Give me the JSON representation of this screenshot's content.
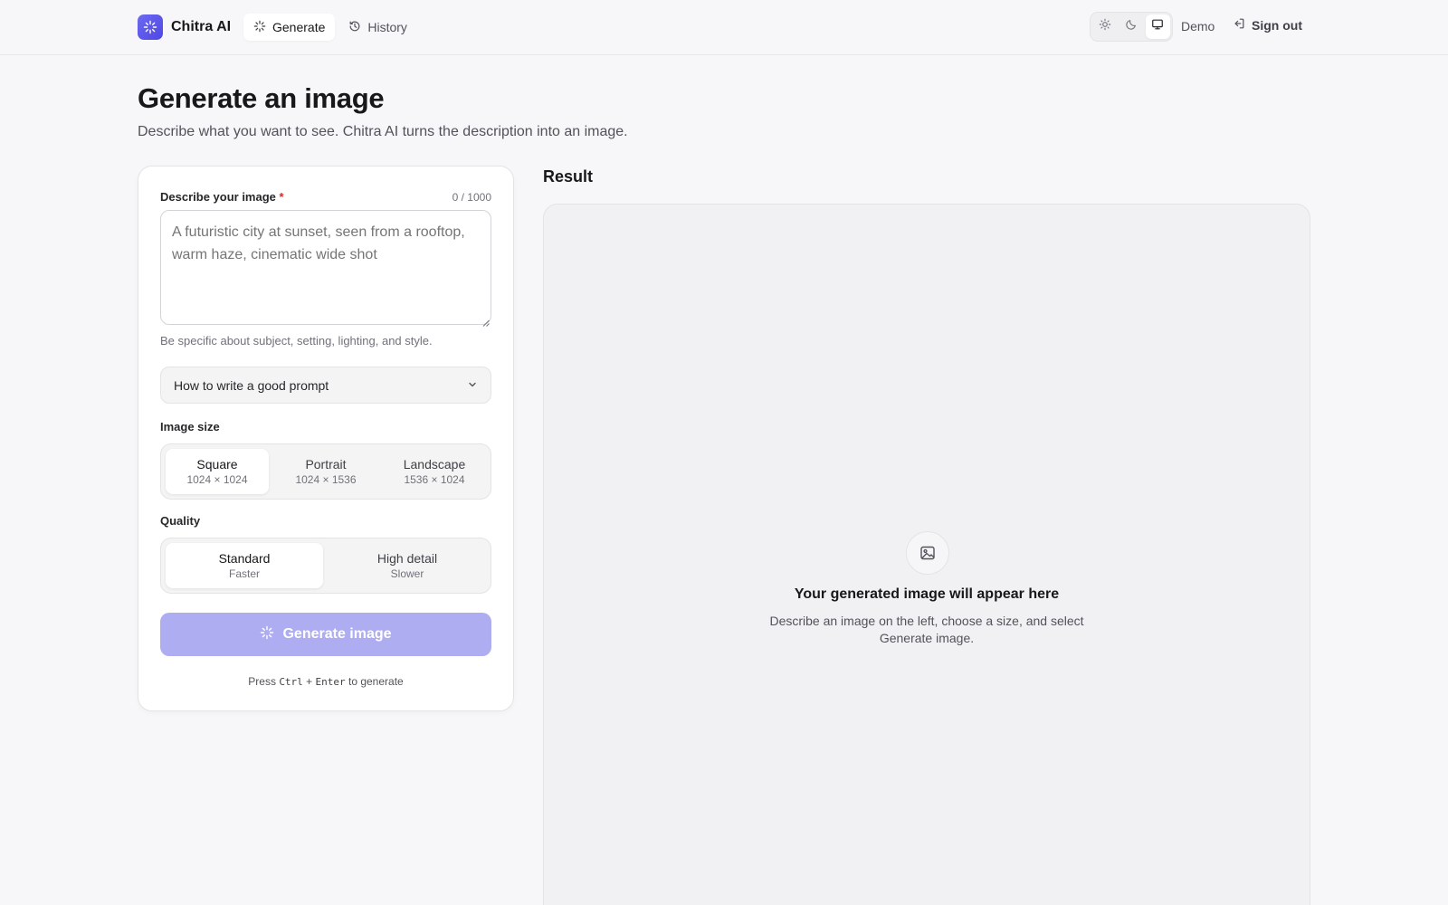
{
  "header": {
    "brand": "Chitra AI",
    "nav": [
      {
        "label": "Generate",
        "icon": "sparkle-icon",
        "active": true
      },
      {
        "label": "History",
        "icon": "history-icon",
        "active": false
      }
    ],
    "theme_options": [
      "light",
      "dark",
      "system"
    ],
    "theme_selected": "system",
    "user": "Demo",
    "sign_out": "Sign out"
  },
  "page": {
    "title": "Generate an image",
    "subtitle": "Describe what you want to see. Chitra AI turns the description into an image."
  },
  "form": {
    "prompt_label": "Describe your image",
    "required_mark": "*",
    "char_count": "0 / 1000",
    "prompt_value": "",
    "prompt_placeholder": "A futuristic city at sunset, seen from a rooftop, warm haze, cinematic wide shot",
    "hint": "Be specific about subject, setting, lighting, and style.",
    "tips_label": "How to write a good prompt",
    "size_label": "Image size",
    "sizes": [
      {
        "title": "Square",
        "sub": "1024 × 1024"
      },
      {
        "title": "Portrait",
        "sub": "1024 × 1536"
      },
      {
        "title": "Landscape",
        "sub": "1536 × 1024"
      }
    ],
    "size_selected": "Square",
    "quality_label": "Quality",
    "qualities": [
      {
        "title": "Standard",
        "sub": "Faster"
      },
      {
        "title": "High detail",
        "sub": "Slower"
      }
    ],
    "quality_selected": "Standard",
    "generate_label": "Generate image",
    "shortcut": {
      "pre": "Press",
      "key1": "Ctrl",
      "plus": "+",
      "key2": "Enter",
      "post": "to generate"
    }
  },
  "result": {
    "title": "Result",
    "empty_title": "Your generated image will appear here",
    "empty_desc": "Describe an image on the left, choose a size, and select Generate image."
  },
  "colors": {
    "accent": "#4f46e5",
    "button_disabled": "#afadf2",
    "background": "#f7f7f9"
  }
}
